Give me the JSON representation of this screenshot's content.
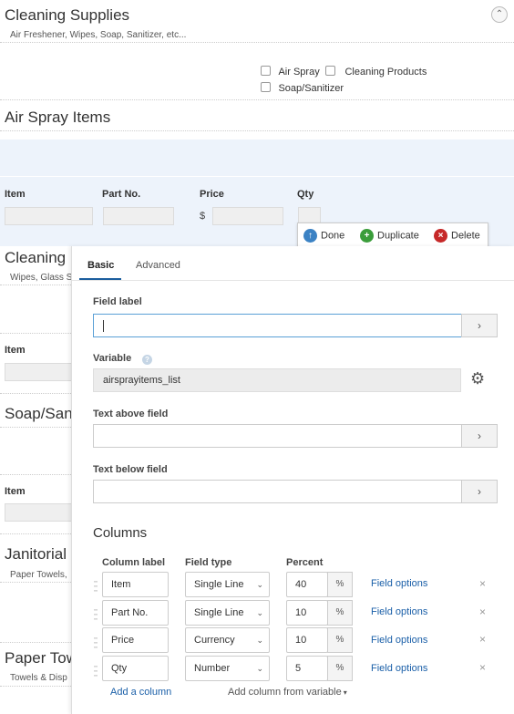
{
  "form": {
    "sections": [
      {
        "title": "Cleaning Supplies",
        "subtitle": "Air Freshener, Wipes, Soap, Sanitizer, etc..."
      },
      {
        "title": "Air Spray Items"
      },
      {
        "title": "Cleaning I",
        "subtitle": "Wipes, Glass S"
      },
      {
        "title": "Soap/Sani"
      },
      {
        "title": "Janitorial S",
        "subtitle": "Paper Towels,"
      },
      {
        "title": "Paper Tow",
        "subtitle": "Towels & Disp"
      }
    ],
    "checkboxes": [
      {
        "label": "Air Spray",
        "checked": false
      },
      {
        "label": "Cleaning Products",
        "checked": false
      },
      {
        "label": "Soap/Sanitizer",
        "checked": false
      }
    ],
    "columns": [
      "Item",
      "Part No.",
      "Price",
      "Qty"
    ],
    "currency_symbol": "$",
    "item_label": "Item"
  },
  "actions": {
    "done": "Done",
    "duplicate": "Duplicate",
    "delete": "Delete"
  },
  "panel": {
    "tabs": [
      {
        "label": "Basic",
        "active": true
      },
      {
        "label": "Advanced",
        "active": false
      }
    ],
    "field_label": {
      "label": "Field label",
      "value": ""
    },
    "variable": {
      "label": "Variable",
      "value": "airsprayitems_list"
    },
    "text_above": {
      "label": "Text above field",
      "value": ""
    },
    "text_below": {
      "label": "Text below field",
      "value": ""
    },
    "columns_section": {
      "title": "Columns",
      "headers": {
        "label": "Column label",
        "type": "Field type",
        "percent": "Percent"
      },
      "rows": [
        {
          "label": "Item",
          "type": "Single Line",
          "percent": "40",
          "options": "Field options"
        },
        {
          "label": "Part No.",
          "type": "Single Line",
          "percent": "10",
          "options": "Field options"
        },
        {
          "label": "Price",
          "type": "Currency",
          "percent": "10",
          "options": "Field options"
        },
        {
          "label": "Qty",
          "type": "Number",
          "percent": "5",
          "options": "Field options"
        }
      ],
      "pct_symbol": "%",
      "add_column": "Add a column",
      "add_from_variable": "Add column from variable"
    }
  },
  "colors": {
    "accent": "#1b5e9e",
    "link": "#1a5fa8",
    "done": "#3b82c4",
    "duplicate": "#3a9d3a",
    "delete": "#c62828",
    "band": "#edf3fb"
  }
}
